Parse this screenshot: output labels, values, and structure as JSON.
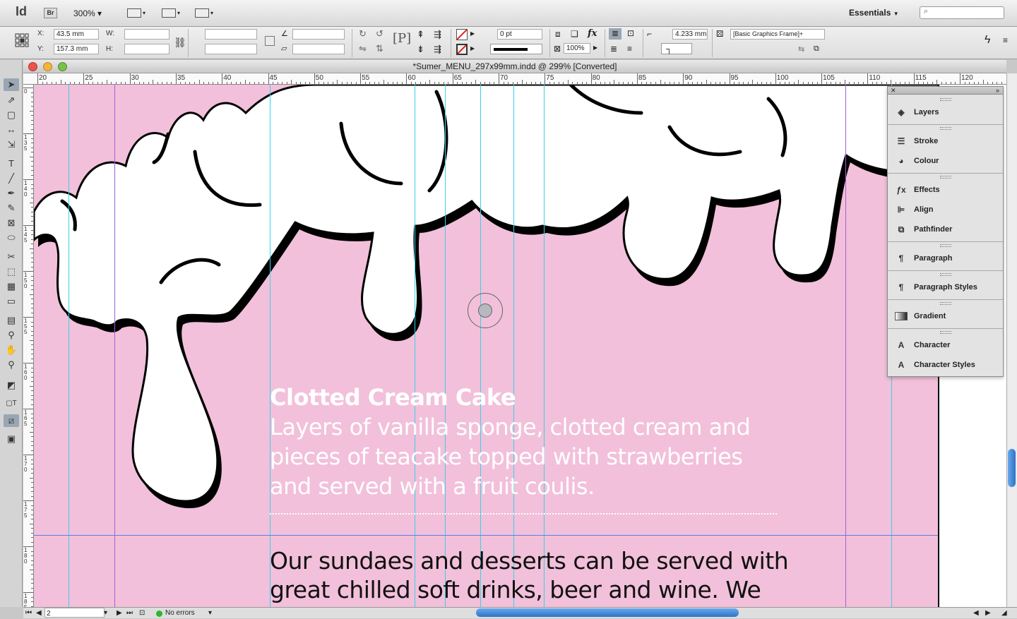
{
  "app": {
    "logo": "Id",
    "bridge": "Br",
    "zoom": "300%",
    "workspace": "Essentials"
  },
  "control": {
    "x_label": "X:",
    "x_value": "43.5 mm",
    "y_label": "Y:",
    "y_value": "157.3 mm",
    "w_label": "W:",
    "h_label": "H:",
    "stroke_weight": "0 pt",
    "opacity": "100%",
    "offset": "4.233 mm",
    "object_style": "[Basic Graphics Frame]+"
  },
  "document": {
    "title": "*Sumer_MENU_297x99mm.indd @ 299% [Converted]"
  },
  "rulers": {
    "h": [
      "20",
      "25",
      "30",
      "35",
      "40",
      "45",
      "50",
      "55",
      "60",
      "65",
      "70",
      "75",
      "80",
      "85",
      "90",
      "95",
      "100",
      "105",
      "110",
      "115",
      "120"
    ],
    "v": [
      "0",
      "135",
      "140",
      "145",
      "150",
      "155",
      "160",
      "165",
      "170",
      "175",
      "180",
      "185"
    ]
  },
  "page": {
    "cake_title": "Clotted Cream Cake",
    "cake_desc": "Layers of vanilla sponge, clotted cream and pieces of teacake topped with strawberries and served with a fruit coulis.",
    "sundae_text": "Our sundaes and desserts can be served with great chilled soft drinks, beer and wine. We"
  },
  "panels": [
    {
      "label": "Layers",
      "icon": "layers-icon"
    },
    {
      "label": "Stroke",
      "icon": "stroke-icon"
    },
    {
      "label": "Colour",
      "icon": "palette-icon"
    },
    {
      "label": "Effects",
      "icon": "fx-icon"
    },
    {
      "label": "Align",
      "icon": "align-icon"
    },
    {
      "label": "Pathfinder",
      "icon": "pathfinder-icon"
    },
    {
      "label": "Paragraph",
      "icon": "pilcrow-icon"
    },
    {
      "label": "Paragraph Styles",
      "icon": "paragraph-styles-icon"
    },
    {
      "label": "Gradient",
      "icon": "gradient-icon"
    },
    {
      "label": "Character",
      "icon": "character-icon"
    },
    {
      "label": "Character Styles",
      "icon": "character-styles-icon"
    }
  ],
  "status": {
    "page": "2",
    "preflight": "No errors"
  },
  "colors": {
    "page_pink": "#f2c0da",
    "guide_cyan": "#38d3e6",
    "guide_violet": "#a060d8",
    "preflight_ok": "#2fb52f"
  }
}
